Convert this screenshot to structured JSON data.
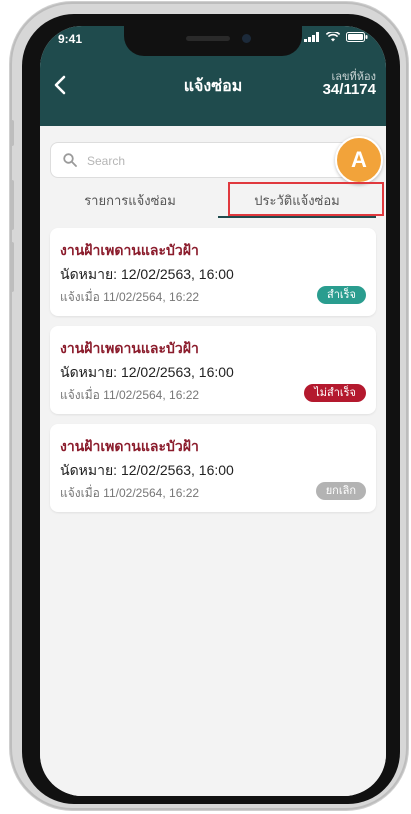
{
  "status_bar": {
    "time": "9:41"
  },
  "header": {
    "title": "แจ้งซ่อม",
    "room_label": "เลขที่ห้อง",
    "room_number": "34/1174"
  },
  "search": {
    "placeholder": "Search",
    "value": ""
  },
  "annotation": {
    "marker": "A"
  },
  "tabs": [
    {
      "label": "รายการแจ้งซ่อม",
      "active": false
    },
    {
      "label": "ประวัติแจ้งซ่อม",
      "active": true
    }
  ],
  "history": [
    {
      "title": "งานฝ้าเพดานและบัวฝ้า",
      "appointment": "นัดหมาย: 12/02/2563, 16:00",
      "reported": "แจ้งเมื่อ 11/02/2564, 16:22",
      "status": "สำเร็จ",
      "status_color": "#2a9d8f"
    },
    {
      "title": "งานฝ้าเพดานและบัวฝ้า",
      "appointment": "นัดหมาย: 12/02/2563, 16:00",
      "reported": "แจ้งเมื่อ 11/02/2564, 16:22",
      "status": "ไม่สำเร็จ",
      "status_color": "#b4192e"
    },
    {
      "title": "งานฝ้าเพดานและบัวฝ้า",
      "appointment": "นัดหมาย: 12/02/2563, 16:00",
      "reported": "แจ้งเมื่อ 11/02/2564, 16:22",
      "status": "ยกเลิก",
      "status_color": "#b3b3b3"
    }
  ],
  "colors": {
    "header_bg": "#1f4b4d",
    "title_text": "#8b1c2c",
    "highlight_border": "#e0393e",
    "marker_bg": "#f2a33a"
  }
}
